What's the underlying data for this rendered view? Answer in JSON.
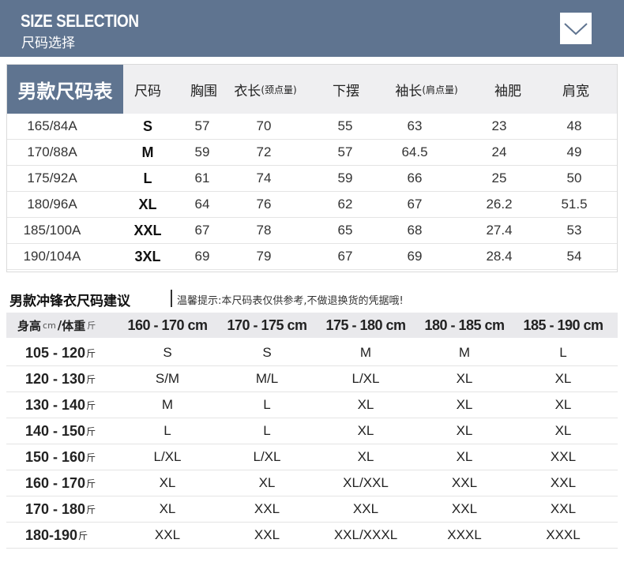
{
  "header": {
    "title_en": "SIZE SELECTION",
    "title_cn": "尺码选择",
    "chevron_icon": "chevron-down-icon",
    "bg_color": "#5f7490"
  },
  "size_table": {
    "badge": "男款尺码表",
    "headers": [
      {
        "main": "尺码",
        "note": ""
      },
      {
        "main": "胸围",
        "note": ""
      },
      {
        "main": "衣长",
        "note": "(颈点量)"
      },
      {
        "main": "下摆",
        "note": ""
      },
      {
        "main": "袖长",
        "note": "(肩点量)"
      },
      {
        "main": "袖肥",
        "note": ""
      },
      {
        "main": "肩宽",
        "note": ""
      }
    ],
    "rows": [
      [
        "165/84A",
        "S",
        "57",
        "70",
        "55",
        "63",
        "23",
        "48"
      ],
      [
        "170/88A",
        "M",
        "59",
        "72",
        "57",
        "64.5",
        "24",
        "49"
      ],
      [
        "175/92A",
        "L",
        "61",
        "74",
        "59",
        "66",
        "25",
        "50"
      ],
      [
        "180/96A",
        "XL",
        "64",
        "76",
        "62",
        "67",
        "26.2",
        "51.5"
      ],
      [
        "185/100A",
        "XXL",
        "67",
        "78",
        "65",
        "68",
        "27.4",
        "53"
      ],
      [
        "190/104A",
        "3XL",
        "69",
        "79",
        "67",
        "69",
        "28.4",
        "54"
      ]
    ]
  },
  "advice": {
    "title": "男款冲锋衣尺码建议",
    "note": "温馨提示:本尺码表仅供参考,不做退换货的凭据哦!",
    "corner_label": {
      "height": "身高",
      "height_unit": "cm",
      "slash": "/",
      "weight": "体重",
      "weight_unit": "斤"
    },
    "height_cols": [
      "160 - 170 cm",
      "170 - 175 cm",
      "175 - 180 cm",
      "180 - 185 cm",
      "185 - 190 cm"
    ],
    "weight_unit": "斤",
    "rows": [
      {
        "weight": "105 - 120",
        "sizes": [
          "S",
          "S",
          "M",
          "M",
          "L"
        ]
      },
      {
        "weight": "120 - 130",
        "sizes": [
          "S/M",
          "M/L",
          "L/XL",
          "XL",
          "XL"
        ]
      },
      {
        "weight": "130 - 140",
        "sizes": [
          "M",
          "L",
          "XL",
          "XL",
          "XL"
        ]
      },
      {
        "weight": "140 - 150",
        "sizes": [
          "L",
          "L",
          "XL",
          "XL",
          "XL"
        ]
      },
      {
        "weight": "150 - 160",
        "sizes": [
          "L/XL",
          "L/XL",
          "XL",
          "XL",
          "XXL"
        ]
      },
      {
        "weight": "160 - 170",
        "sizes": [
          "XL",
          "XL",
          "XL/XXL",
          "XXL",
          "XXL"
        ]
      },
      {
        "weight": "170 - 180",
        "sizes": [
          "XL",
          "XXL",
          "XXL",
          "XXL",
          "XXL"
        ]
      },
      {
        "weight": "180-190",
        "sizes": [
          "XXL",
          "XXL",
          "XXL/XXXL",
          "XXXL",
          "XXXL"
        ]
      }
    ]
  }
}
